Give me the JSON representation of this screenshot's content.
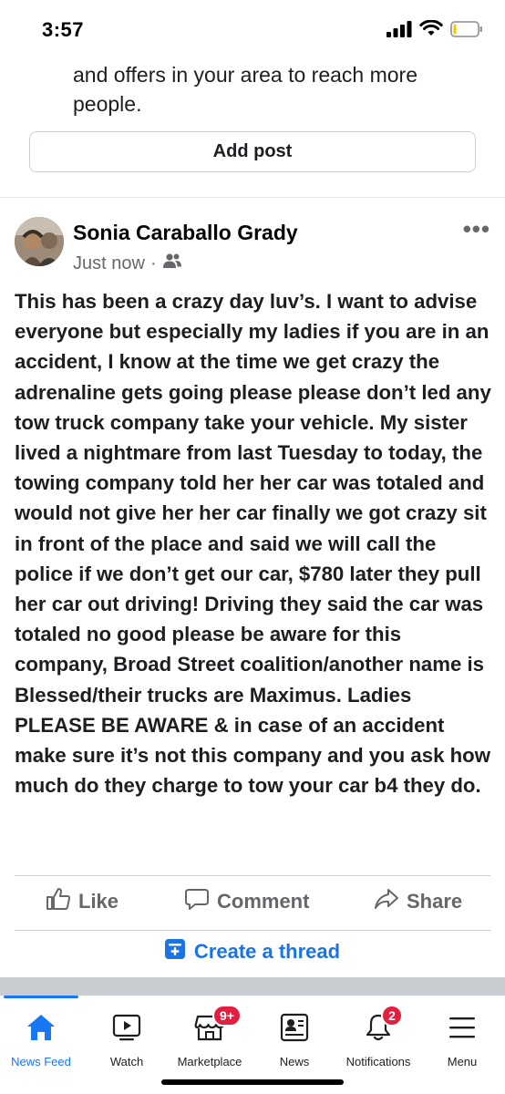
{
  "status": {
    "time": "3:57"
  },
  "previous_card": {
    "text": "and offers in your area to reach more people.",
    "add_post_label": "Add post"
  },
  "post": {
    "author": "Sonia Caraballo Grady",
    "timestamp": "Just now",
    "separator": "·",
    "audience_icon": "friends-icon",
    "more_label": "•••",
    "body": "This has been a crazy day luv’s. I want to advise everyone but especially my ladies if you are in an accident, I know at the time we get crazy the adrenaline gets going please please don’t led any tow truck company take your vehicle. My sister lived a nightmare from last Tuesday to today, the towing company told her her car was totaled and would not give her her car finally we got crazy sit in front of the place and said we will call the police if we don’t get our car, $780 later they pull her car out driving! Driving they said the car was totaled no good please be aware for this company, Broad Street coalition/another name is Blessed/their trucks are  Maximus. Ladies PLEASE BE AWARE & in case of an accident make sure it’s not this company and you ask how much do they charge to tow your car  b4 they do.",
    "actions": {
      "like": "Like",
      "comment": "Comment",
      "share": "Share"
    },
    "thread_label": "Create a thread"
  },
  "tabbar": {
    "tabs": [
      {
        "label": "News Feed",
        "icon": "home-icon",
        "active": true
      },
      {
        "label": "Watch",
        "icon": "watch-icon"
      },
      {
        "label": "Marketplace",
        "icon": "marketplace-icon",
        "badge": "9+"
      },
      {
        "label": "News",
        "icon": "news-icon"
      },
      {
        "label": "Notifications",
        "icon": "bell-icon",
        "badge": "2"
      },
      {
        "label": "Menu",
        "icon": "menu-icon"
      }
    ]
  },
  "colors": {
    "accent": "#1877f2",
    "badge": "#e41e3f",
    "secondary_text": "#65676b"
  }
}
